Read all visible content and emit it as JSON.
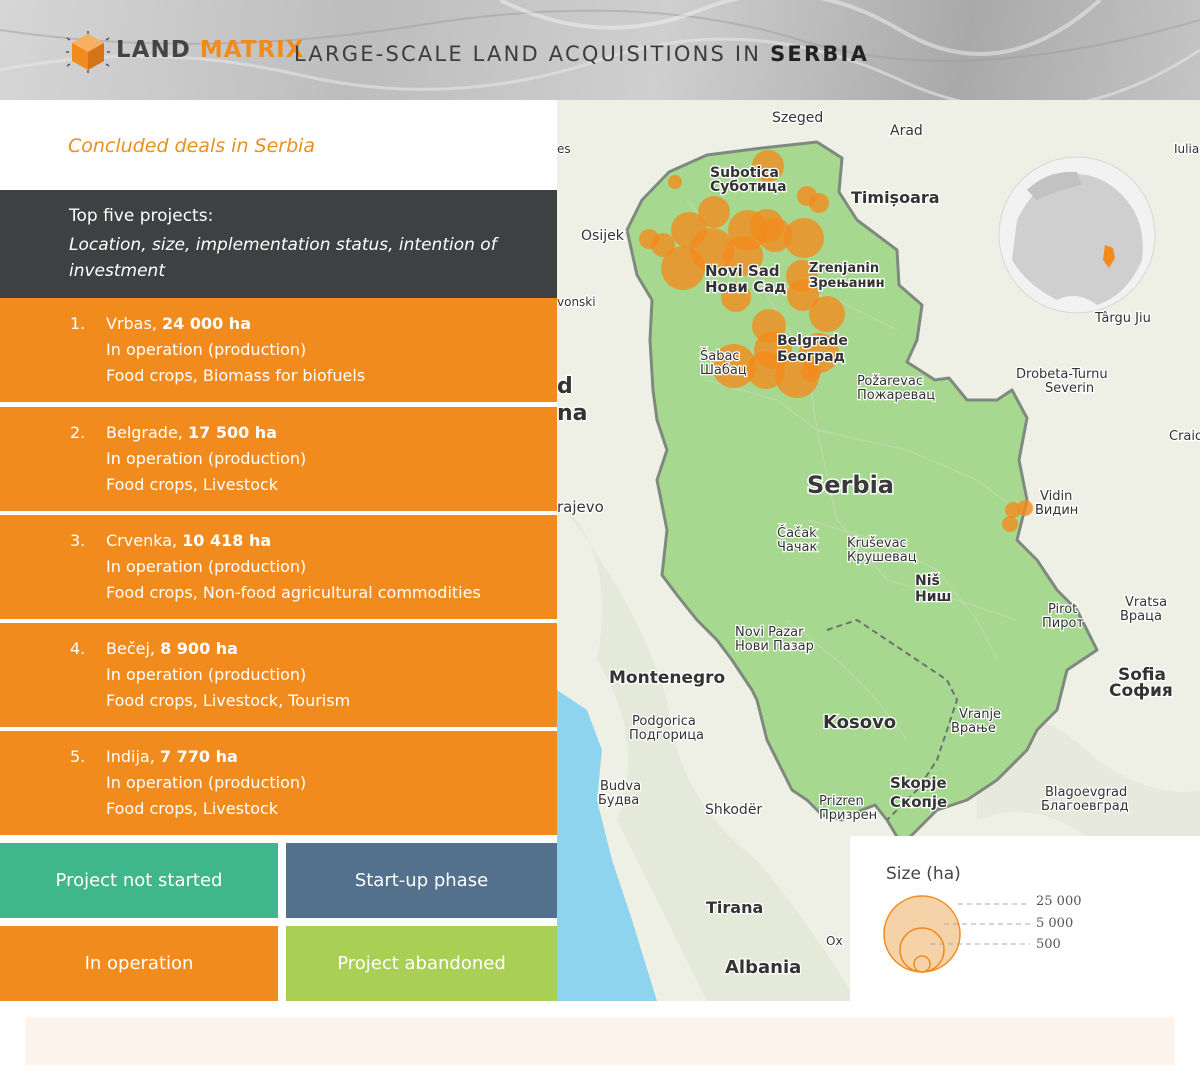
{
  "header": {
    "logo_word1": "LAND",
    "logo_word2": "MATRIX",
    "title_prefix": "LARGE-SCALE LAND ACQUISITIONS IN",
    "title_country": "SERBIA"
  },
  "panel": {
    "subtitle": "Concluded deals in Serbia",
    "top_five_title": "Top five projects:",
    "top_five_desc": "Location, size, implementation status, intention of investment"
  },
  "projects": [
    {
      "num": "1.",
      "location": "Vrbas,",
      "size": "24 000 ha",
      "status": "In operation (production)",
      "intention": "Food crops, Biomass for biofuels"
    },
    {
      "num": "2.",
      "location": "Belgrade,",
      "size": "17 500 ha",
      "status": "In operation (production)",
      "intention": "Food crops, Livestock"
    },
    {
      "num": "3.",
      "location": "Crvenka,",
      "size": "10 418 ha",
      "status": "In operation (production)",
      "intention": "Food crops, Non-food agricultural commodities"
    },
    {
      "num": "4.",
      "location": "Bečej,",
      "size": "8 900 ha",
      "status": "In operation (production)",
      "intention": "Food crops, Livestock, Tourism"
    },
    {
      "num": "5.",
      "location": "Indija,",
      "size": "7 770 ha",
      "status": "In operation (production)",
      "intention": "Food crops, Livestock"
    }
  ],
  "status_legend": [
    {
      "label": "Project not started",
      "color": "#3fb68b"
    },
    {
      "label": "Start-up phase",
      "color": "#53708c"
    },
    {
      "label": "In operation",
      "color": "#f28b1e"
    },
    {
      "label": "Project abandoned",
      "color": "#a9cf54"
    }
  ],
  "map": {
    "country_label": "Serbia",
    "labels": [
      {
        "text": "Szeged"
      },
      {
        "text": "Arad"
      },
      {
        "text": "Subotica"
      },
      {
        "text": "Суботица"
      },
      {
        "text": "Timișoara"
      },
      {
        "text": "Osijek"
      },
      {
        "text": "Novi Sad"
      },
      {
        "text": "Нови Сад"
      },
      {
        "text": "Zrenjanin"
      },
      {
        "text": "Зрењанин"
      },
      {
        "text": "Belgrade"
      },
      {
        "text": "Београд"
      },
      {
        "text": "Šabac"
      },
      {
        "text": "Шабац"
      },
      {
        "text": "Požarevac"
      },
      {
        "text": "Пожаревац"
      },
      {
        "text": "Drobeta-Turnu"
      },
      {
        "text": "Severin"
      },
      {
        "text": "Târgu Jiu"
      },
      {
        "text": "Craio"
      },
      {
        "text": "Vidin"
      },
      {
        "text": "Видин"
      },
      {
        "text": "rajevo"
      },
      {
        "text": "Čačak"
      },
      {
        "text": "Чачак"
      },
      {
        "text": "Kruševac"
      },
      {
        "text": "Крушевац"
      },
      {
        "text": "Niš"
      },
      {
        "text": "Ниш"
      },
      {
        "text": "Pirot"
      },
      {
        "text": "Пирот"
      },
      {
        "text": "Vratsa"
      },
      {
        "text": "Враца"
      },
      {
        "text": "Novi Pazar"
      },
      {
        "text": "Нови Пазар"
      },
      {
        "text": "Montenegro"
      },
      {
        "text": "Sofia"
      },
      {
        "text": "София"
      },
      {
        "text": "Kosovo"
      },
      {
        "text": "Vranje"
      },
      {
        "text": "Врање"
      },
      {
        "text": "Podgorica"
      },
      {
        "text": "Подгорица"
      },
      {
        "text": "Budva"
      },
      {
        "text": "Будва"
      },
      {
        "text": "Shkodër"
      },
      {
        "text": "Prizren"
      },
      {
        "text": "Призрен"
      },
      {
        "text": "Skopje"
      },
      {
        "text": "Скопје"
      },
      {
        "text": "Blagoevgrad"
      },
      {
        "text": "Благоевград"
      },
      {
        "text": "Tirana"
      },
      {
        "text": "Albania"
      },
      {
        "text": "vonski"
      },
      {
        "text": "es"
      },
      {
        "text": "Iulia"
      },
      {
        "text": "d"
      },
      {
        "text": "na"
      },
      {
        "text": "Ox"
      }
    ],
    "deal_color": "#f28b1e"
  },
  "size_legend": {
    "title": "Size (ha)",
    "values": [
      "25 000",
      "5 000",
      "500"
    ]
  }
}
